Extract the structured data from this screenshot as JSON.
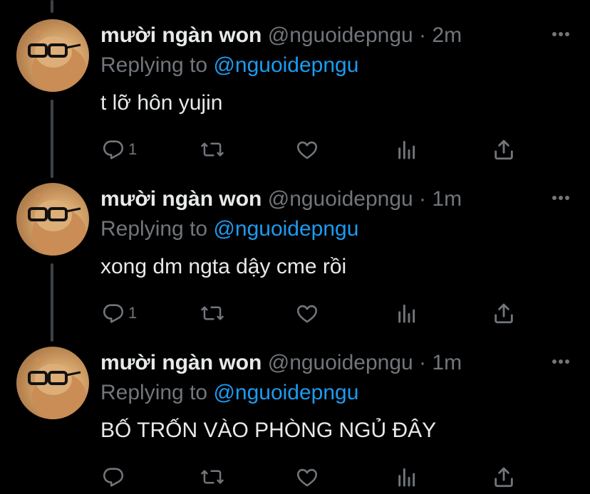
{
  "colors": {
    "background": "#000000",
    "primary_text": "#e7e9ea",
    "secondary_text": "#71767b",
    "accent": "#1d9bf0",
    "thread_line": "#3d4247"
  },
  "icons": [
    "more-icon",
    "reply-icon",
    "retweet-icon",
    "like-icon",
    "analytics-icon",
    "share-icon"
  ],
  "tweets": [
    {
      "display_name": "mười ngàn won",
      "handle": "@nguoidepngu",
      "separator": "·",
      "time": "2m",
      "reply_prefix": "Replying to ",
      "reply_target": "@nguoidepngu",
      "text": "t lỡ hôn yujin",
      "reply_count": "1"
    },
    {
      "display_name": "mười ngàn won",
      "handle": "@nguoidepngu",
      "separator": "·",
      "time": "1m",
      "reply_prefix": "Replying to ",
      "reply_target": "@nguoidepngu",
      "text": "xong dm ngta dậy cme rồi",
      "reply_count": "1"
    },
    {
      "display_name": "mười ngàn won",
      "handle": "@nguoidepngu",
      "separator": "·",
      "time": "1m",
      "reply_prefix": "Replying to ",
      "reply_target": "@nguoidepngu",
      "text": "BỐ TRỐN VÀO PHÒNG NGỦ ĐÂY",
      "reply_count": ""
    }
  ]
}
